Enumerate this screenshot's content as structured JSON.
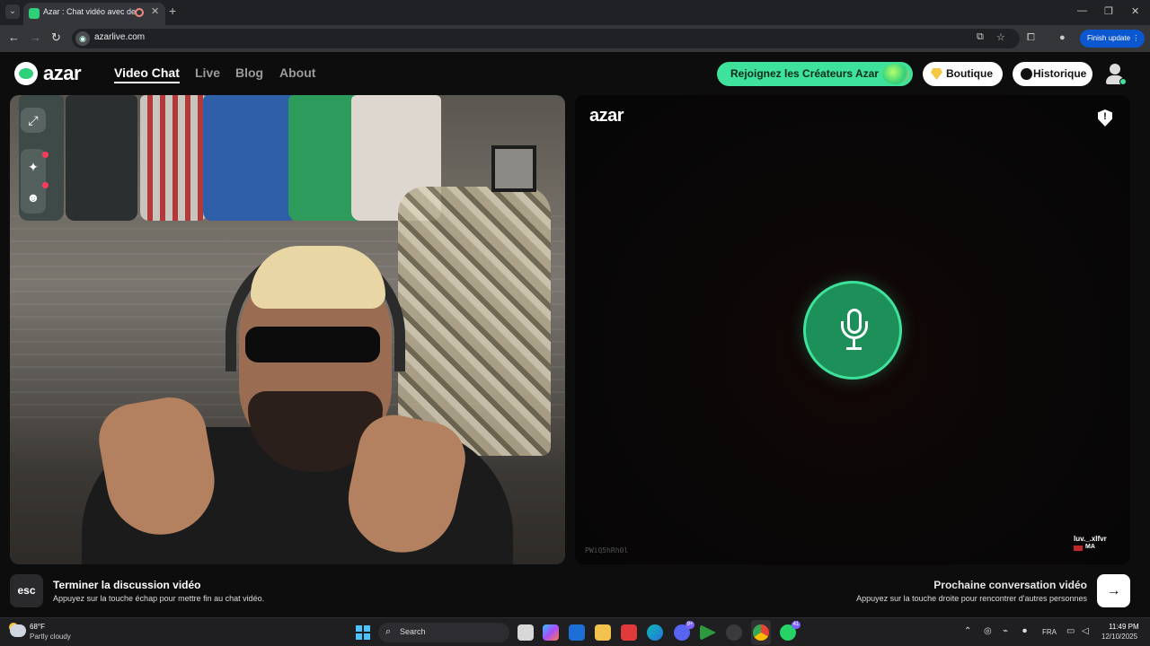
{
  "browser": {
    "tab_title": "Azar : Chat vidéo avec de n",
    "url": "azarlive.com",
    "finish_update_label": "Finish update"
  },
  "header": {
    "logo_text": "azar",
    "nav": [
      {
        "label": "Video Chat",
        "active": true
      },
      {
        "label": "Live",
        "active": false
      },
      {
        "label": "Blog",
        "active": false
      },
      {
        "label": "About",
        "active": false
      }
    ],
    "creators_label": "Rejoignez les Créateurs Azar",
    "boutique_label": "Boutique",
    "historique_label": "Historique"
  },
  "remote_panel": {
    "logo_text": "azar",
    "session_code": "PWiQ5hRh0l",
    "peer_name": "luv._.xlfvr",
    "peer_country": "MA"
  },
  "footer": {
    "esc_key": "esc",
    "end_title": "Terminer la discussion vidéo",
    "end_subtitle": "Appuyez sur la touche échap pour mettre fin au chat vidéo.",
    "next_title": "Prochaine conversation vidéo",
    "next_subtitle": "Appuyez sur la touche droite pour rencontrer d'autres personnes"
  },
  "taskbar": {
    "weather_temp": "68°F",
    "weather_desc": "Partly cloudy",
    "search_placeholder": "Search",
    "discord_badge": "9+",
    "whatsapp_badge": "41",
    "language": "FRA",
    "time": "11:49 PM",
    "date": "12/10/2025"
  },
  "colors": {
    "accent_green": "#3ee29a",
    "mic_green": "#1d8f58",
    "finish_update_blue": "#0b57d0"
  }
}
